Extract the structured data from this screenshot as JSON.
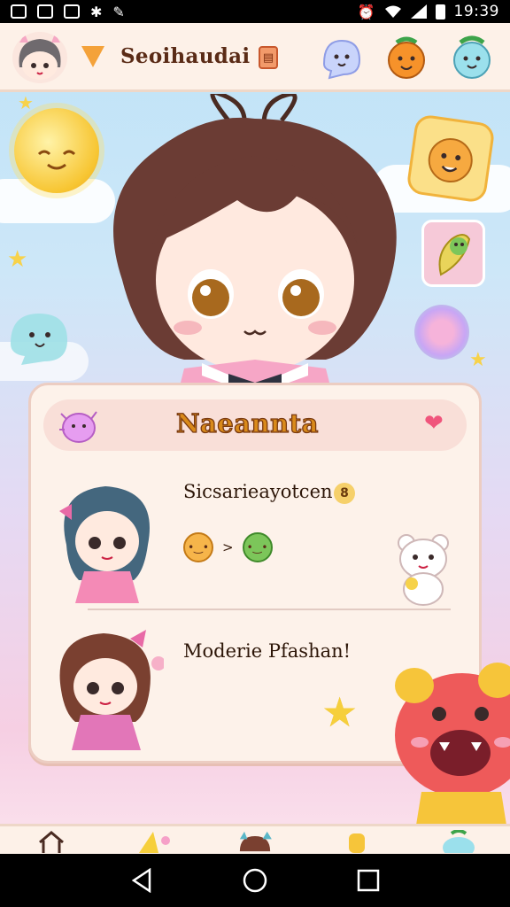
{
  "status_bar": {
    "time": "19:39",
    "left_icons": [
      "gallery-icon",
      "image-icon",
      "photo-icon",
      "settings-icon",
      "edit-icon"
    ],
    "right_icons": [
      "alarm-icon",
      "wifi-icon",
      "signal-icon",
      "battery-icon"
    ]
  },
  "header": {
    "title": "Seoihaudai",
    "avatar": "avatar-icon",
    "logo": "triangle-logo-icon",
    "badge_icon": "badge-icon",
    "mascots": [
      "ghost-mascot-icon",
      "orange-mascot-icon",
      "blue-mascot-icon"
    ]
  },
  "panel": {
    "title": "Naeannta",
    "heart_icon": "heart-icon",
    "blob_icon": "pink-blob-icon",
    "entries": [
      {
        "name": "Sicsarieayotcen",
        "badge": "8",
        "moods": [
          "orange-face-icon",
          "green-face-icon"
        ],
        "mood_separator": ">",
        "pet_icon": "white-bear-icon"
      },
      {
        "name": "Moderie Pfashan!"
      }
    ],
    "star_icon": "star-icon"
  },
  "bottom_nav": [
    "home-icon",
    "sparkle-icon",
    "cat-icon",
    "crown-icon",
    "leaf-icon"
  ],
  "system_nav": [
    "back-icon",
    "home-circle-icon",
    "recents-icon"
  ],
  "colors": {
    "header_bg": "#fdf1e8",
    "panel_bg": "#fdf2ea",
    "title_text": "#5a2b16",
    "panel_title_fill": "#d98a1a",
    "heart": "#f0557c"
  }
}
